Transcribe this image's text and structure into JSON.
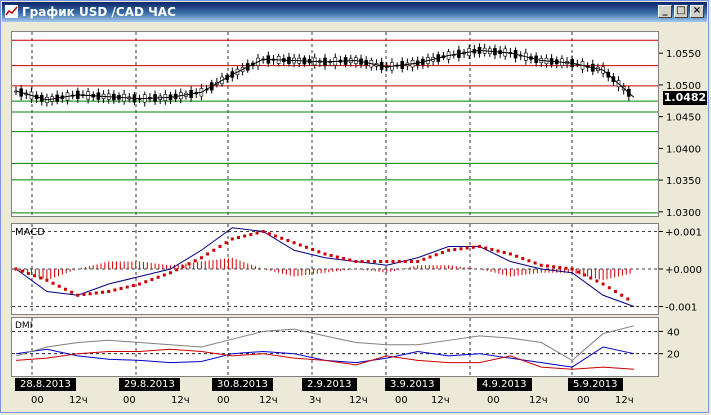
{
  "window": {
    "title": "График USD /CAD  ЧАС",
    "icon": "chart-app-icon",
    "buttons": [
      "_",
      "□",
      "×"
    ]
  },
  "colors": {
    "price_line": "#000000",
    "resistance_line": "#cc0000",
    "support_line": "#008000",
    "macd_line": "#000080",
    "signal_dots": "#cc0000",
    "macd_histogram": "#cc0000",
    "dmi_plus": "#0000cc",
    "dmi_minus": "#cc0000",
    "adx": "#808080"
  },
  "price_panel": {
    "current_price": "1.0482",
    "y_ticks": [
      "1.0550",
      "1.0500",
      "1.0450",
      "1.0400",
      "1.0350",
      "1.0300"
    ]
  },
  "macd_panel": {
    "label": "MACD",
    "y_ticks": [
      "+0.001",
      "+0.000",
      "-0.001"
    ]
  },
  "dmi_panel": {
    "label": "DMI",
    "y_ticks": [
      "40",
      "20"
    ]
  },
  "time_axis": {
    "dates": [
      "28.8.2013",
      "29.8.2013",
      "30.8.2013",
      "2.9.2013",
      "3.9.2013",
      "4.9.2013",
      "5.9.2013"
    ],
    "hours": [
      "00",
      "12ч",
      "00",
      "12ч",
      "00",
      "12ч",
      "3ч",
      "12ч",
      "00",
      "12ч",
      "00",
      "12ч",
      "00",
      "12ч"
    ]
  },
  "chart_data": [
    {
      "type": "line",
      "title": "",
      "ylim": [
        1.0295,
        1.0585
      ],
      "x": [
        0,
        6,
        12,
        18,
        24,
        30,
        36,
        42,
        48,
        54,
        60,
        66,
        72,
        78,
        84,
        90,
        96,
        102,
        108,
        114,
        120
      ],
      "series": [
        {
          "values": [
            1.0492,
            1.0478,
            1.0486,
            1.0483,
            1.048,
            1.0482,
            1.049,
            1.0518,
            1.0542,
            1.054,
            1.0538,
            1.054,
            1.053,
            1.0536,
            1.0548,
            1.0556,
            1.0552,
            1.054,
            1.0536,
            1.0525,
            1.0482
          ]
        }
      ],
      "reference_lines": {
        "resistance": [
          1.0572,
          1.0532,
          1.05
        ],
        "support": [
          1.0476,
          1.0459,
          1.0428,
          1.0378,
          1.0352,
          1.03
        ]
      }
    },
    {
      "type": "line",
      "title": "MACD",
      "ylim": [
        -0.0012,
        0.0012
      ],
      "x": [
        0,
        6,
        12,
        18,
        24,
        30,
        36,
        42,
        48,
        54,
        60,
        66,
        72,
        78,
        84,
        90,
        96,
        102,
        108,
        114,
        120
      ],
      "series": [
        {
          "values": [
            0.0,
            -0.0006,
            -0.0007,
            -0.0004,
            -0.0002,
            0.0,
            0.0005,
            0.0011,
            0.001,
            0.0005,
            0.0003,
            0.0002,
            0.0001,
            0.0003,
            0.0006,
            0.0006,
            0.0002,
            0.0,
            -0.0001,
            -0.0007,
            -0.001
          ]
        },
        {
          "values": [
            0.0,
            -0.0003,
            -0.0007,
            -0.0006,
            -0.0004,
            -0.0001,
            0.0003,
            0.0008,
            0.001,
            0.0007,
            0.0004,
            0.0002,
            0.0002,
            0.0002,
            0.0005,
            0.0006,
            0.0004,
            0.0001,
            0.0,
            -0.0004,
            -0.0009
          ]
        }
      ],
      "histogram": [
        0.0,
        -0.0003,
        0.0,
        0.0002,
        0.0002,
        0.0001,
        0.0002,
        0.0003,
        0.0,
        -0.0002,
        -0.0001,
        0.0,
        -0.0001,
        0.0001,
        0.0001,
        0.0,
        -0.0002,
        -0.0001,
        -0.0001,
        -0.0003,
        -0.0001
      ]
    },
    {
      "type": "line",
      "title": "DMI",
      "ylim": [
        0,
        52
      ],
      "x": [
        0,
        6,
        12,
        18,
        24,
        30,
        36,
        42,
        48,
        54,
        60,
        66,
        72,
        78,
        84,
        90,
        96,
        102,
        108,
        114,
        120
      ],
      "series": [
        {
          "values": [
            20,
            24,
            18,
            15,
            14,
            12,
            13,
            20,
            22,
            20,
            14,
            12,
            16,
            22,
            18,
            20,
            16,
            12,
            8,
            26,
            20
          ]
        },
        {
          "values": [
            14,
            16,
            20,
            22,
            22,
            24,
            22,
            18,
            20,
            16,
            14,
            10,
            18,
            14,
            12,
            12,
            18,
            8,
            6,
            8,
            6
          ]
        },
        {
          "values": [
            18,
            26,
            30,
            32,
            30,
            28,
            26,
            33,
            40,
            42,
            36,
            30,
            28,
            28,
            32,
            36,
            34,
            30,
            14,
            38,
            45
          ]
        }
      ]
    }
  ]
}
